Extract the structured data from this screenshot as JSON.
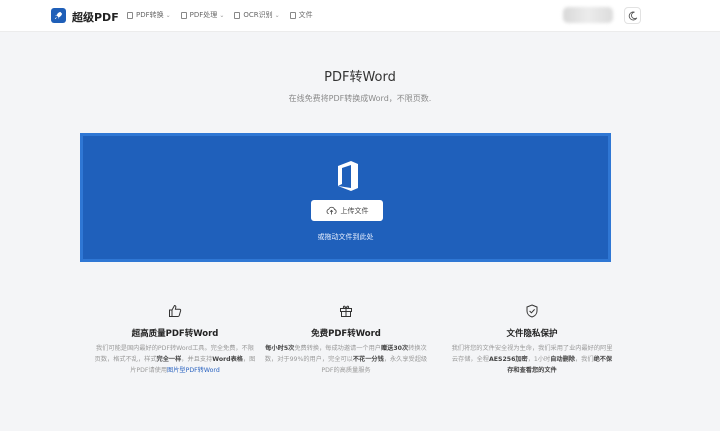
{
  "brand": "超级PDF",
  "nav": [
    {
      "label": "PDF转换",
      "dropdown": true
    },
    {
      "label": "PDF处理",
      "dropdown": true
    },
    {
      "label": "OCR识别",
      "dropdown": true
    },
    {
      "label": "文件",
      "dropdown": false
    }
  ],
  "hero": {
    "title": "PDF转Word",
    "subtitle": "在线免费将PDF转换成Word，不限页数."
  },
  "upload": {
    "button_label": "上传文件",
    "drag_hint": "或拖动文件到此处"
  },
  "features": [
    {
      "title": "超高质量PDF转Word",
      "text_1": "我们可能是国内最好的PDF转Word工具。完全免费，不限页数，格式不乱，样式",
      "bold_1": "完全一样",
      "text_2": "，并且支持",
      "bold_2": "Word表格",
      "text_3": "，图片PDF请使用",
      "link": "图片型PDF转Word"
    },
    {
      "title": "免费PDF转Word",
      "bold_1": "每小时5次",
      "text_1": "免费转换，每成功邀请一个用户",
      "bold_2": "赠送30次",
      "text_2": "转换次数，对于99%的用户，完全可以",
      "bold_3": "不花一分钱",
      "text_3": "，永久享受超级PDF的高质量服务"
    },
    {
      "title": "文件隐私保护",
      "text_1": "我们将您的文件安全视为生命，我们采用了业内最好的阿里云存储，全程",
      "bold_1": "AES256加密",
      "text_2": "，1小时",
      "bold_2": "自动删除",
      "text_3": "，我们",
      "bold_3": "绝不保存和查看您的文件"
    }
  ],
  "colors": {
    "accent": "#1f60bb",
    "upload_border": "#2f77d4",
    "link": "#2a63c0"
  }
}
